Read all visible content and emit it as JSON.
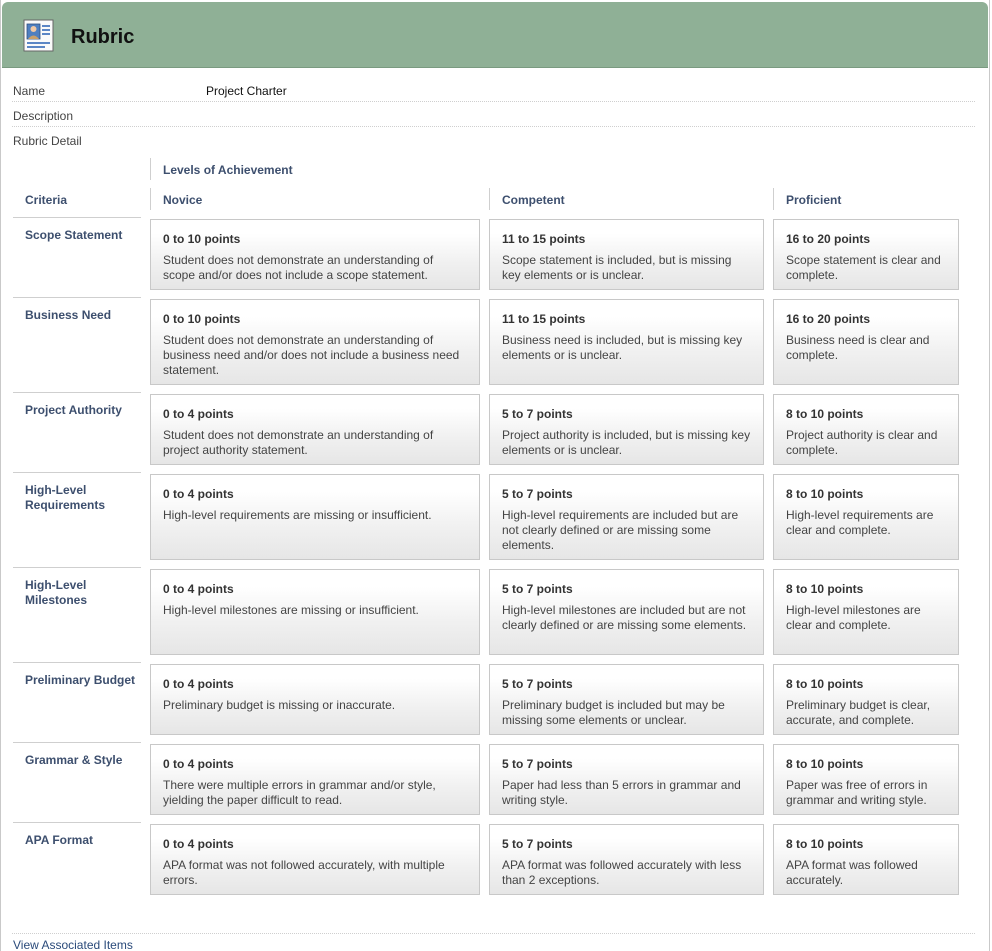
{
  "header": {
    "title": "Rubric",
    "icon": "rubric-document-icon"
  },
  "meta": {
    "name_label": "Name",
    "name_value": "Project Charter",
    "description_label": "Description",
    "description_value": "",
    "detail_label": "Rubric Detail"
  },
  "table": {
    "levels_label": "Levels of Achievement",
    "criteria_label": "Criteria",
    "columns": [
      "Novice",
      "Competent",
      "Proficient"
    ],
    "rows": [
      {
        "criterion": "Scope Statement",
        "cells": [
          {
            "points": "0 to 10 points",
            "desc": "Student does not demonstrate an understanding of scope and/or does not include a scope statement."
          },
          {
            "points": "11 to 15 points",
            "desc": "Scope statement is included, but is missing key elements or is unclear."
          },
          {
            "points": "16 to 20 points",
            "desc": "Scope statement is clear and complete."
          }
        ]
      },
      {
        "criterion": "Business Need",
        "cells": [
          {
            "points": "0 to 10 points",
            "desc": "Student does not demonstrate an understanding of business need and/or does not include a business need statement."
          },
          {
            "points": "11 to 15 points",
            "desc": "Business need is included, but is missing key elements or is unclear."
          },
          {
            "points": "16 to 20 points",
            "desc": "Business need is clear and complete."
          }
        ]
      },
      {
        "criterion": "Project Authority",
        "cells": [
          {
            "points": "0 to 4 points",
            "desc": "Student does not demonstrate an understanding of project authority statement."
          },
          {
            "points": "5 to 7 points",
            "desc": "Project authority is included, but is missing key elements or is unclear."
          },
          {
            "points": "8 to 10 points",
            "desc": "Project authority is clear and complete."
          }
        ]
      },
      {
        "criterion": "High-Level Requirements",
        "cells": [
          {
            "points": "0 to 4 points",
            "desc": "High-level requirements are missing or insufficient."
          },
          {
            "points": "5 to 7 points",
            "desc": "High-level requirements are included but are not clearly defined or are missing some elements."
          },
          {
            "points": "8 to 10 points",
            "desc": "High-level requirements are clear and complete."
          }
        ]
      },
      {
        "criterion": "High-Level Milestones",
        "cells": [
          {
            "points": "0 to 4 points",
            "desc": "High-level milestones are missing or insufficient."
          },
          {
            "points": "5 to 7 points",
            "desc": "High-level milestones are included but are not clearly defined or are missing some elements."
          },
          {
            "points": "8 to 10 points",
            "desc": "High-level milestones are clear and complete."
          }
        ]
      },
      {
        "criterion": "Preliminary Budget",
        "cells": [
          {
            "points": "0 to 4 points",
            "desc": "Preliminary budget is missing or inaccurate."
          },
          {
            "points": "5 to 7 points",
            "desc": "Preliminary budget is included but may be missing some elements or unclear."
          },
          {
            "points": "8 to 10 points",
            "desc": "Preliminary budget is clear, accurate, and complete."
          }
        ]
      },
      {
        "criterion": "Grammar & Style",
        "cells": [
          {
            "points": "0 to 4 points",
            "desc": "There were multiple errors in grammar and/or style, yielding the paper difficult to read."
          },
          {
            "points": "5 to 7 points",
            "desc": "Paper had less than 5 errors in grammar and writing style."
          },
          {
            "points": "8 to 10 points",
            "desc": "Paper was free of errors in grammar and writing style."
          }
        ]
      },
      {
        "criterion": "APA Format",
        "cells": [
          {
            "points": "0 to 4 points",
            "desc": "APA format was not followed accurately, with multiple errors."
          },
          {
            "points": "5 to 7 points",
            "desc": "APA format was followed accurately with less than 2 exceptions."
          },
          {
            "points": "8 to 10 points",
            "desc": "APA format was followed accurately."
          }
        ]
      }
    ]
  },
  "footer": {
    "link_label": "View Associated Items"
  },
  "colors": {
    "header_bg": "#8fb096",
    "label_blue": "#3d4f6e",
    "link_blue": "#2a4a7a"
  }
}
